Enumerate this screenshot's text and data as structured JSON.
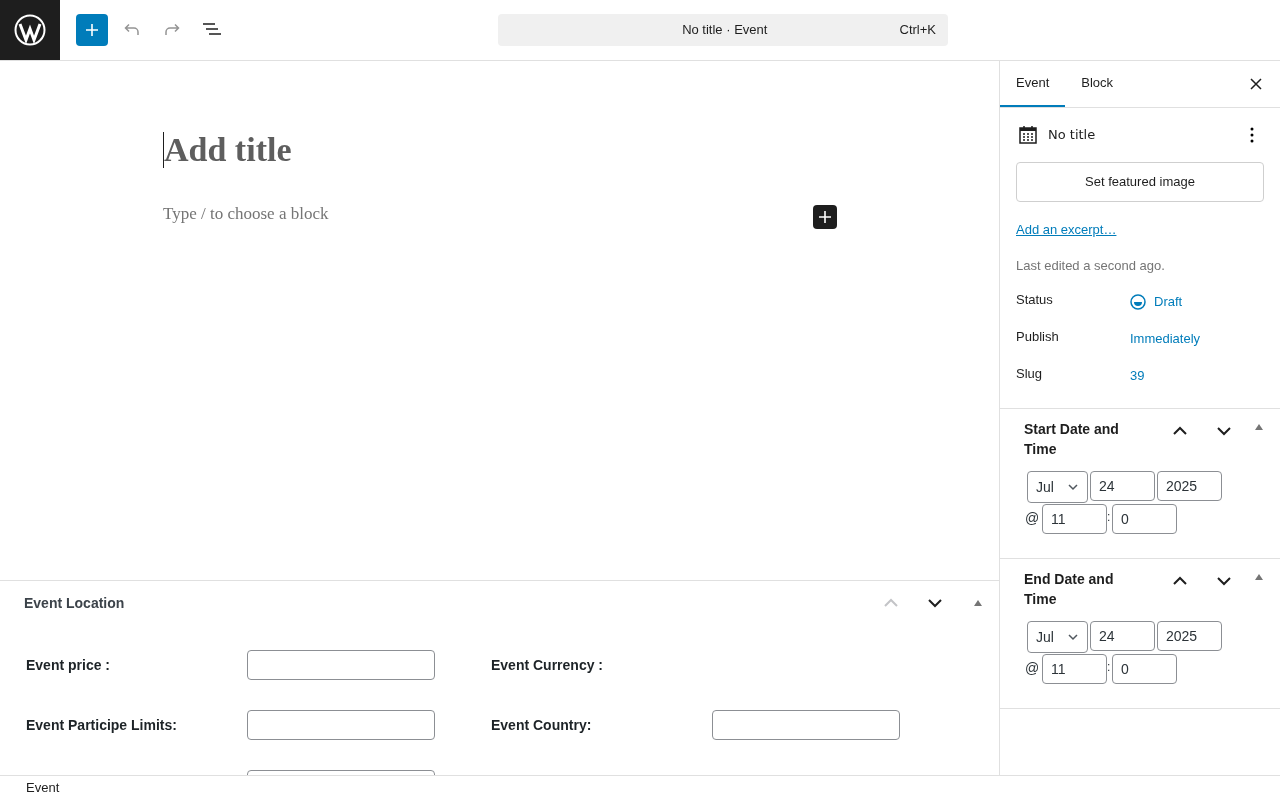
{
  "toolbar": {
    "command_title": "No title · Event",
    "shortcut": "Ctrl+K"
  },
  "editor": {
    "title_placeholder": "Add title",
    "block_placeholder": "Type / to choose a block"
  },
  "meta_box": {
    "title": "Event Location",
    "fields": [
      {
        "kind": "input",
        "label": "Event price :"
      },
      {
        "kind": "label_only",
        "label": "Event Currency :"
      },
      {
        "kind": "input",
        "label": "Event Participe Limits:"
      },
      {
        "kind": "input",
        "label": "Event Country:"
      },
      {
        "kind": "input"
      }
    ]
  },
  "sidebar": {
    "tabs": [
      {
        "label": "Event",
        "selected": true
      },
      {
        "label": "Block",
        "selected": false
      }
    ],
    "post_title": "No title",
    "featured_button": "Set featured image",
    "excerpt_link": "Add an excerpt…",
    "last_edited": "Last edited a second ago.",
    "meta": [
      {
        "label": "Status",
        "value": "Draft",
        "kind": "status"
      },
      {
        "label": "Publish",
        "value": "Immediately",
        "kind": "link"
      },
      {
        "label": "Slug",
        "value": "39",
        "kind": "link"
      }
    ],
    "panels": [
      {
        "title": "Start Date and Time",
        "month": "Jul",
        "day": "24",
        "year": "2025",
        "at": "@",
        "hour": "11",
        "sep": ":",
        "minute": "0"
      },
      {
        "title": "End Date and Time",
        "month": "Jul",
        "day": "24",
        "year": "2025",
        "at": "@",
        "hour": "11",
        "sep": ":",
        "minute": "0"
      }
    ]
  },
  "footer": {
    "breadcrumb": "Event"
  }
}
